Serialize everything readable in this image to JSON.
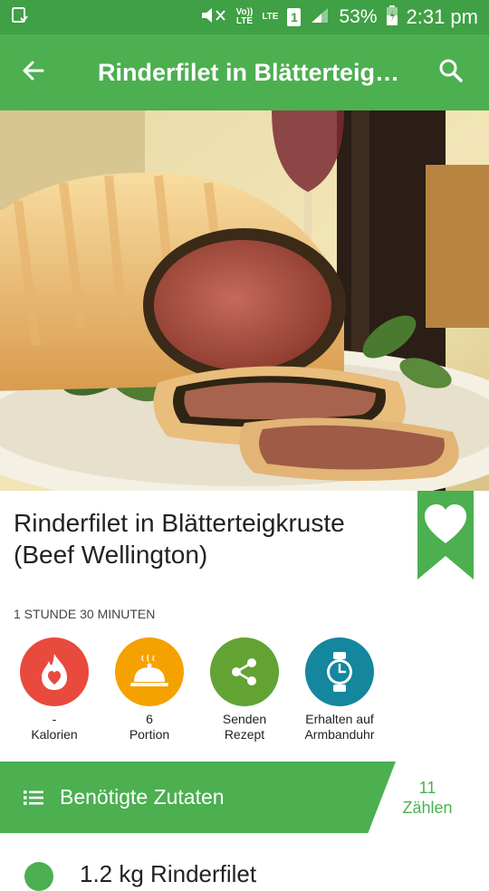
{
  "status_bar": {
    "volte": "Vo))",
    "volte_lte": "LTE",
    "lte": "LTE",
    "sim": "1",
    "battery": "53%",
    "time": "2:31 pm"
  },
  "app_bar": {
    "title": "Rinderfilet in Blätterteigkruste (Beef Wellington)"
  },
  "recipe": {
    "title": "Rinderfilet in Blätterteigkruste (Beef Wellington)",
    "duration": "1 STUNDE 30 MINUTEN",
    "favorite": true
  },
  "actions": [
    {
      "value": "-",
      "label": "Kalorien",
      "color": "#e84a3d",
      "icon": "calories-flame-heart-icon"
    },
    {
      "value": "6",
      "label": "Portion",
      "color": "#f5a100",
      "icon": "serving-cloche-icon"
    },
    {
      "value": "Senden",
      "label": "Rezept",
      "color": "#62a334",
      "icon": "share-icon"
    },
    {
      "value": "Erhalten auf",
      "label": "Armbanduhr",
      "color": "#14869e",
      "icon": "smartwatch-icon"
    }
  ],
  "ingredients": {
    "header": "Benötigte Zutaten",
    "count": "11",
    "count_label": "Zählen",
    "first_item": "1.2 kg Rinderfilet"
  },
  "colors": {
    "primary": "#4caf50",
    "status_bar": "#3fa045"
  }
}
